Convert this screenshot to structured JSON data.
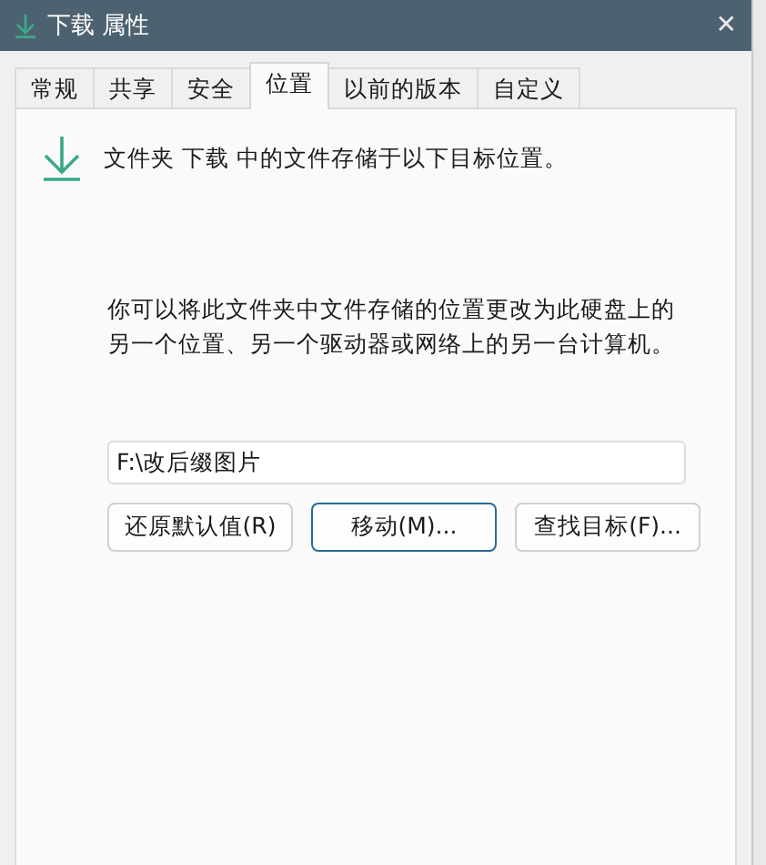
{
  "window": {
    "title": "下载 属性",
    "close": "✕"
  },
  "tabs": [
    {
      "label": "常规",
      "selected": false
    },
    {
      "label": "共享",
      "selected": false
    },
    {
      "label": "安全",
      "selected": false
    },
    {
      "label": "位置",
      "selected": true
    },
    {
      "label": "以前的版本",
      "selected": false
    },
    {
      "label": "自定义",
      "selected": false
    }
  ],
  "heading": "文件夹 下载 中的文件存储于以下目标位置。",
  "description": "你可以将此文件夹中文件存储的位置更改为此硬盘上的另一个位置、另一个驱动器或网络上的另一台计算机。",
  "path_field": {
    "value": "F:\\改后缀图片"
  },
  "buttons": [
    {
      "label": "还原默认值(R)",
      "default": false
    },
    {
      "label": "移动(M)...",
      "default": true
    },
    {
      "label": "查找目标(F)..."
    }
  ]
}
